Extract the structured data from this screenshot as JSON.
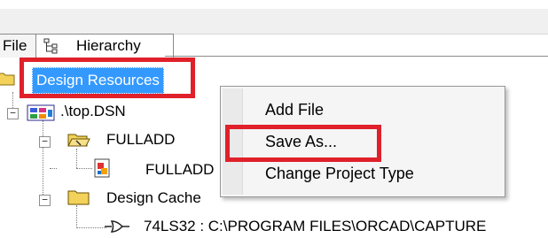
{
  "tabs": [
    {
      "label": "File"
    },
    {
      "label": "Hierarchy"
    }
  ],
  "tree": {
    "root": {
      "label": "Design Resources"
    },
    "design": {
      "label": ".\\top.DSN"
    },
    "folder_fulladd": {
      "label": "FULLADD"
    },
    "schematic_fulladd": {
      "label": "FULLADD"
    },
    "design_cache": {
      "label": "Design Cache"
    },
    "cache_part": {
      "label": "74LS32 : C:\\PROGRAM FILES\\ORCAD\\CAPTURE"
    }
  },
  "context_menu": {
    "items": [
      {
        "label": "Add File"
      },
      {
        "label": "Save As..."
      },
      {
        "label": "Change Project Type"
      }
    ]
  },
  "colors": {
    "highlight": "#e0202a",
    "selection": "#3399ff"
  }
}
